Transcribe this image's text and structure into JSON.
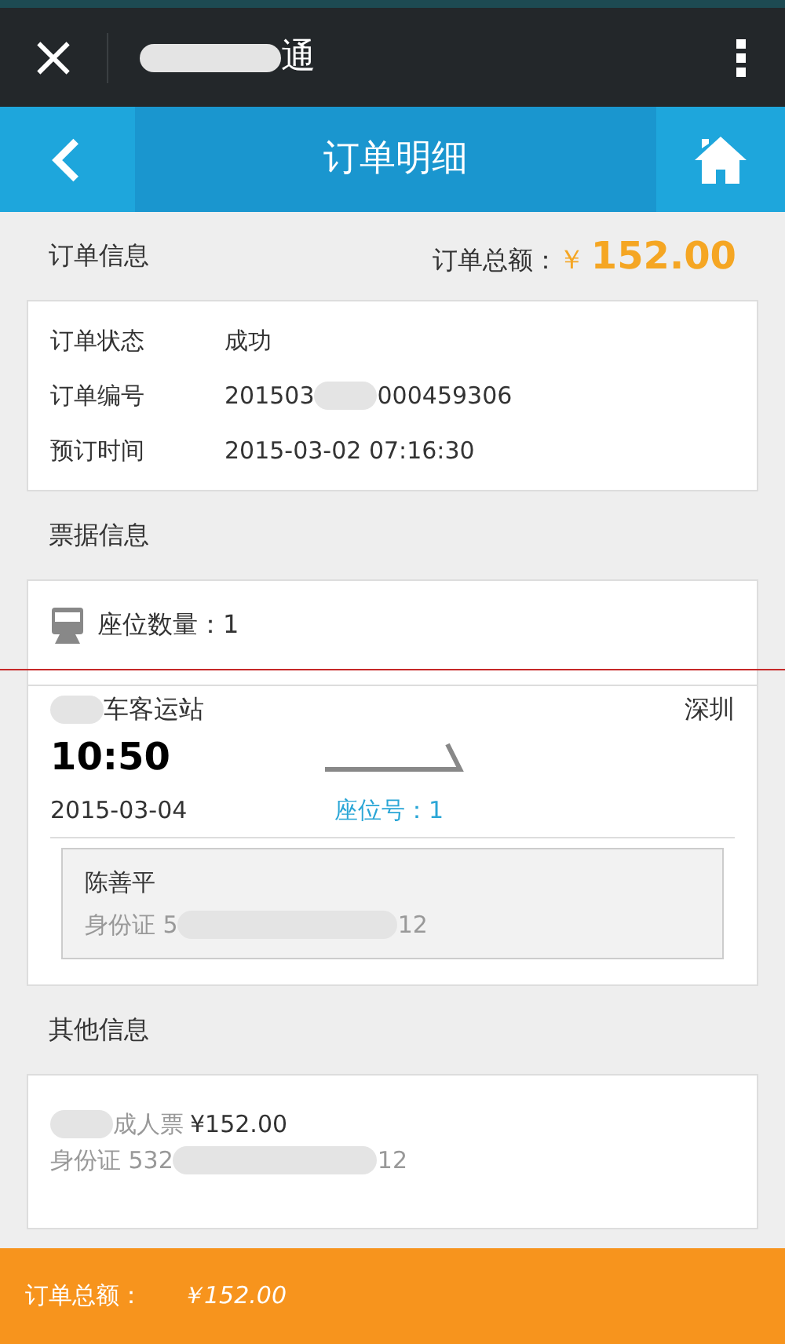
{
  "top_bar": {
    "title_parts": [
      "通"
    ]
  },
  "nav": {
    "title": "订单明细"
  },
  "order_info": {
    "heading": "订单信息",
    "total_label": "订单总额：",
    "currency": "￥",
    "total": "152.00",
    "rows": [
      {
        "label": "订单状态",
        "value_parts": [
          "成功"
        ]
      },
      {
        "label": "订单编号",
        "value_parts": [
          "201503",
          "000459306"
        ]
      },
      {
        "label": "预订时间",
        "value_parts": [
          "2015-03-02 07:16:30"
        ]
      }
    ]
  },
  "ticket_info": {
    "heading": "票据信息",
    "seat_count": "座位数量：1",
    "trip": {
      "from_parts": [
        "车客运站"
      ],
      "from_redacted_start": true,
      "to": "深圳",
      "time": "10:50",
      "date": "2015-03-04",
      "seat": "座位号：1",
      "passenger": {
        "name": "陈善平",
        "id_parts": [
          "身份证 5",
          "12"
        ]
      }
    }
  },
  "other_info": {
    "heading": "其他信息",
    "passenger_parts": [
      "成人票"
    ],
    "passenger_redacted_start": true,
    "price": "¥152.00",
    "id_parts": [
      "身份证 532",
      "12"
    ]
  },
  "footer": {
    "label": "订单总额：",
    "amount": "￥152.00"
  }
}
